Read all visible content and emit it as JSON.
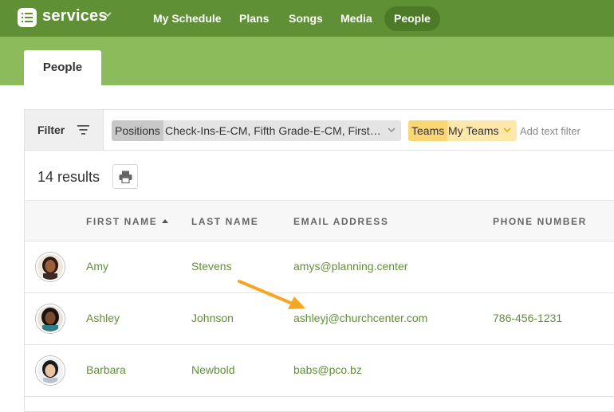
{
  "app": {
    "brand": "services",
    "nav": [
      {
        "label": "My Schedule"
      },
      {
        "label": "Plans"
      },
      {
        "label": "Songs"
      },
      {
        "label": "Media"
      },
      {
        "label": "People",
        "active": true
      }
    ]
  },
  "tabs": {
    "active_label": "People"
  },
  "filter": {
    "button_label": "Filter",
    "positions": {
      "key": "Positions",
      "value": "Check-Ins-E-CM, Fifth Grade-E-CM, First Grade-E-CM"
    },
    "teams": {
      "key": "Teams",
      "value": "My Teams"
    },
    "text_placeholder": "Add text filter",
    "text_value": ""
  },
  "results": {
    "count_label": "14 results",
    "print_icon": "printer-icon"
  },
  "table": {
    "columns": [
      "FIRST NAME",
      "LAST NAME",
      "EMAIL ADDRESS",
      "PHONE NUMBER"
    ],
    "sorted_by": "FIRST NAME",
    "rows": [
      {
        "first": "Amy",
        "last": "Stevens",
        "email": "amys@planning.center",
        "phone": ""
      },
      {
        "first": "Ashley",
        "last": "Johnson",
        "email": "ashleyj@churchcenter.com",
        "phone": "786-456-1231"
      },
      {
        "first": "Barbara",
        "last": "Newbold",
        "email": "babs@pco.bz",
        "phone": ""
      }
    ]
  },
  "colors": {
    "topbar": "#5f9035",
    "subbar": "#8bbb5b",
    "link": "#5f9035",
    "teams_chip": "#fde7a9",
    "annotation_arrow": "#f5a623"
  }
}
